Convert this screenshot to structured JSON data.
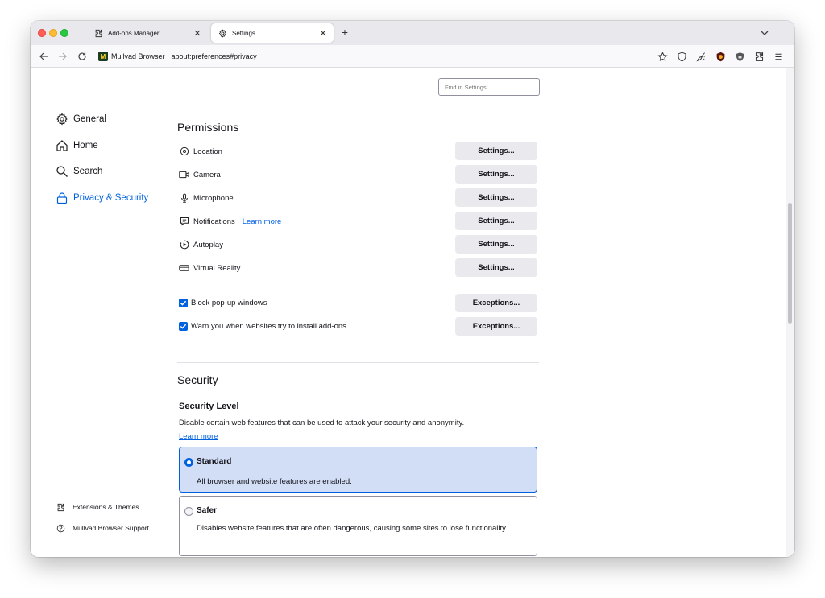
{
  "browser": {
    "tabs": [
      {
        "label": "Add-ons Manager",
        "icon": "puzzle-icon",
        "active": false
      },
      {
        "label": "Settings",
        "icon": "gear-icon",
        "active": true
      }
    ],
    "identity_label": "Mullvad Browser",
    "url": "about:preferences#privacy",
    "toolbar_icons": [
      "star-icon",
      "shield-icon",
      "broom-icon",
      "ublock-icon",
      "noscript-icon",
      "extensions-icon",
      "menu-icon"
    ]
  },
  "search": {
    "placeholder": "Find in Settings"
  },
  "sidebar": {
    "items": [
      {
        "label": "General",
        "icon": "gear-icon"
      },
      {
        "label": "Home",
        "icon": "home-icon"
      },
      {
        "label": "Search",
        "icon": "search-icon"
      },
      {
        "label": "Privacy & Security",
        "icon": "lock-icon",
        "selected": true
      }
    ],
    "footer": [
      {
        "label": "Extensions & Themes",
        "icon": "puzzle-icon"
      },
      {
        "label": "Mullvad Browser Support",
        "icon": "help-icon"
      }
    ]
  },
  "permissions": {
    "title": "Permissions",
    "rows": [
      {
        "label": "Location",
        "button": "Settings..."
      },
      {
        "label": "Camera",
        "button": "Settings..."
      },
      {
        "label": "Microphone",
        "button": "Settings..."
      },
      {
        "label": "Notifications",
        "link": "Learn more",
        "button": "Settings..."
      },
      {
        "label": "Autoplay",
        "button": "Settings..."
      },
      {
        "label": "Virtual Reality",
        "button": "Settings..."
      }
    ],
    "checks": [
      {
        "label": "Block pop-up windows",
        "checked": true,
        "button": "Exceptions..."
      },
      {
        "label": "Warn you when websites try to install add-ons",
        "checked": true,
        "button": "Exceptions..."
      }
    ]
  },
  "security": {
    "title": "Security",
    "level_title": "Security Level",
    "description": "Disable certain web features that can be used to attack your security and anonymity.",
    "learn_more": "Learn more",
    "options": [
      {
        "label": "Standard",
        "description": "All browser and website features are enabled.",
        "selected": true
      },
      {
        "label": "Safer",
        "description": "Disables website features that are often dangerous, causing some sites to lose functionality.",
        "selected": false
      }
    ]
  },
  "colors": {
    "accent": "#0061e0",
    "selected_card": "#d2ddf6",
    "button_bg": "#eaeaee"
  }
}
